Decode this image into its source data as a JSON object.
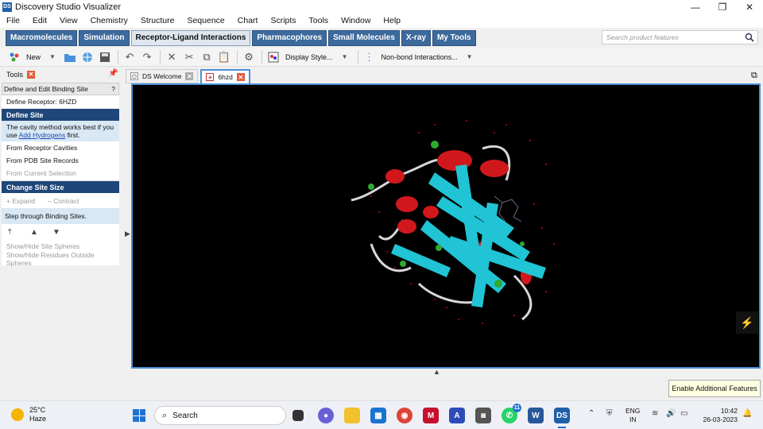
{
  "window": {
    "title": "Discovery Studio Visualizer",
    "app_icon": "DS",
    "controls": [
      "—",
      "❐",
      "✕"
    ]
  },
  "menu": [
    "File",
    "Edit",
    "View",
    "Chemistry",
    "Structure",
    "Sequence",
    "Chart",
    "Scripts",
    "Tools",
    "Window",
    "Help"
  ],
  "ribbon": {
    "tabs": [
      "Macromolecules",
      "Simulation",
      "Receptor-Ligand Interactions",
      "Pharmacophores",
      "Small Molecules",
      "X-ray",
      "My Tools"
    ],
    "active_index": 2,
    "search_placeholder": "Search product features"
  },
  "toolbar": {
    "new_label": "New",
    "display_style_label": "Display Style...",
    "nonbond_label": "Non-bond Interactions..."
  },
  "tools_panel": {
    "tab_label": "Tools",
    "header": "Define and Edit Binding Site",
    "help": "?",
    "receptor": "Define Receptor: 6HZD",
    "define_site": "Define Site",
    "note_prefix": "The cavity method works best if you use ",
    "note_link": "Add Hydrogens",
    "note_suffix": " first.",
    "from_cavities": "From Receptor Cavities",
    "from_pdb": "From PDB Site Records",
    "from_selection": "From Current Selection",
    "change_size": "Change Site Size",
    "expand": "+ Expand",
    "contract": "– Contract",
    "step_through": "Step through Binding Sites.",
    "show_hide_spheres": "Show/Hide Site Spheres",
    "show_hide_residues": "Show/Hide Residues Outside Spheres"
  },
  "doc_tabs": [
    {
      "label": "DS Welcome"
    },
    {
      "label": "6hzd"
    }
  ],
  "enable_tip": "Enable Additional Features",
  "taskbar": {
    "weather_temp": "25°C",
    "weather_desc": "Haze",
    "search_label": "Search",
    "whatsapp_badge": "11",
    "lang_1": "ENG",
    "lang_2": "IN",
    "time": "10:42",
    "date": "26-03-2023"
  },
  "colors": {
    "ribbon_tab": "#3d6a9c",
    "section_header": "#1f4678",
    "helix": "#d0181c",
    "strand": "#20c4d4",
    "coil": "#d8d8d8",
    "turn": "#2fa82f",
    "viewer_bg": "#000000"
  }
}
